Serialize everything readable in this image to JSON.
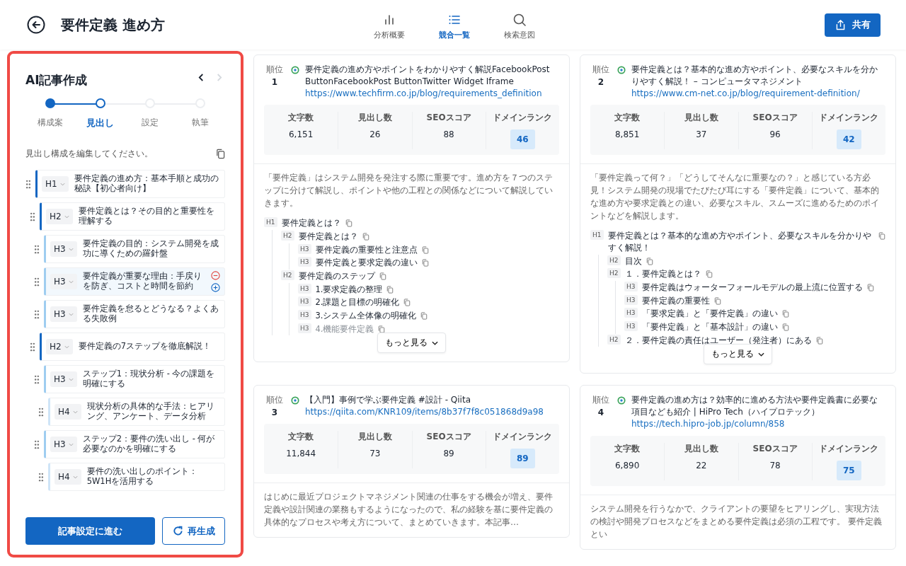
{
  "header": {
    "title": "要件定義 進め方",
    "tabs": [
      {
        "label": "分析概要",
        "kind": "bars",
        "selected": false
      },
      {
        "label": "競合一覧",
        "kind": "list",
        "selected": true
      },
      {
        "label": "検索意図",
        "kind": "search",
        "selected": false
      }
    ],
    "share_button": "共有"
  },
  "panel": {
    "title": "AI記事作成",
    "steps": [
      {
        "label": "構成案",
        "completed": true,
        "selected": false
      },
      {
        "label": "見出し",
        "completed": false,
        "selected": true
      },
      {
        "label": "設定",
        "completed": false,
        "selected": false
      },
      {
        "label": "執筆",
        "completed": false,
        "selected": false
      }
    ],
    "instruction": "見出し構成を編集してください。",
    "headings": [
      {
        "level": "H1",
        "text": "要件定義の進め方：基本手順と成功の秘訣【初心者向け】",
        "selected": false,
        "children": [
          {
            "level": "H2",
            "text": "要件定義とは？その目的と重要性を理解する",
            "selected": false,
            "children": [
              {
                "level": "H3",
                "text": "要件定義の目的：システム開発を成功に導くための羅針盤",
                "selected": false
              },
              {
                "level": "H3",
                "text": "要件定義が重要な理由：手戻りを防ぎ、コストと時間を節約",
                "selected": true
              },
              {
                "level": "H3",
                "text": "要件定義を怠るとどうなる？よくある失敗例",
                "selected": false
              }
            ]
          },
          {
            "level": "H2",
            "text": "要件定義の7ステップを徹底解説！",
            "selected": false,
            "children": [
              {
                "level": "H3",
                "text": "ステップ1：現状分析 - 今の課題を明確にする",
                "selected": false,
                "children": [
                  {
                    "level": "H4",
                    "text": "現状分析の具体的な手法：ヒアリング、アンケート、データ分析",
                    "selected": false
                  }
                ]
              },
              {
                "level": "H3",
                "text": "ステップ2：要件の洗い出し - 何が必要なのかを明確にする",
                "selected": false,
                "children": [
                  {
                    "level": "H4",
                    "text": "要件の洗い出しのポイント：5W1Hを活用する",
                    "selected": false
                  }
                ]
              }
            ]
          }
        ]
      }
    ],
    "primary_button": "記事設定に進む",
    "secondary_button": "再生成"
  },
  "cards": [
    {
      "rank_label": "順位",
      "rank": "1",
      "title": "要件定義の進め方やポイントをわかりやすく解説FacebookPost ButtonFacebookPost ButtonTwitter Widget Iframe",
      "url": "https://www.techfirm.co.jp/blog/requirements_definition",
      "stats": [
        {
          "label": "文字数",
          "value": "6,151",
          "kind": "plain"
        },
        {
          "label": "見出し数",
          "value": "26",
          "kind": "plain"
        },
        {
          "label": "SEOスコア",
          "value": "88",
          "kind": "plain"
        },
        {
          "label": "ドメインランク",
          "value": "46",
          "kind": "badge"
        }
      ],
      "description": "「要件定義」はシステム開発を発注する際に重要です。進め方を７つのステップに分けて解説し、ポイントや他の工程との関係などについて解説していきます。",
      "outline": [
        {
          "level": "H1",
          "text": "要件定義とは？",
          "children": [
            {
              "level": "H2",
              "text": "要件定義とは？",
              "children": [
                {
                  "level": "H3",
                  "text": "要件定義の重要性と注意点"
                },
                {
                  "level": "H3",
                  "text": "要件定義と要求定義の違い"
                }
              ]
            },
            {
              "level": "H2",
              "text": "要件定義のステップ",
              "children": [
                {
                  "level": "H3",
                  "text": "1.要求定義の整理"
                },
                {
                  "level": "H3",
                  "text": "2.課題と目標の明確化"
                },
                {
                  "level": "H3",
                  "text": "3.システム全体像の明確化"
                },
                {
                  "level": "H3",
                  "text": "4.機能要件定義",
                  "faded": true
                }
              ]
            }
          ]
        }
      ],
      "more_button": "もっと見る"
    },
    {
      "rank_label": "順位",
      "rank": "2",
      "title": "要件定義とは？基本的な進め方やポイント、必要なスキルを分かりやすく解説！ – コンピュータマネジメント",
      "url": "https://www.cm-net.co.jp/blog/requirement-definition/",
      "stats": [
        {
          "label": "文字数",
          "value": "8,851",
          "kind": "plain"
        },
        {
          "label": "見出し数",
          "value": "37",
          "kind": "plain"
        },
        {
          "label": "SEOスコア",
          "value": "96",
          "kind": "plain"
        },
        {
          "label": "ドメインランク",
          "value": "42",
          "kind": "badge"
        }
      ],
      "description": "「要件定義って何？」「どうしてそんなに重要なの？」と感じている方必見！システム開発の現場でたびたび耳にする「要件定義」について、基本的な進め方や要求定義との違い、必要なスキル、スムーズに進めるためのポイントなどを解説します。",
      "outline": [
        {
          "level": "H1",
          "text": "要件定義とは？基本的な進め方やポイント、必要なスキルを分かりやすく解説！",
          "children": [
            {
              "level": "H2",
              "text": "目次"
            },
            {
              "level": "H2",
              "text": "１．要件定義とは？",
              "children": [
                {
                  "level": "H3",
                  "text": "要件定義はウォーターフォールモデルの最上流に位置する"
                },
                {
                  "level": "H3",
                  "text": "要件定義の重要性"
                },
                {
                  "level": "H3",
                  "text": "「要求定義」と「要件定義」の違い"
                },
                {
                  "level": "H3",
                  "text": "「要件定義」と「基本設計」の違い"
                }
              ]
            },
            {
              "level": "H2",
              "text": "２．要件定義の責任はユーザー（発注者）にある"
            }
          ]
        }
      ],
      "more_button": "もっと見る"
    },
    {
      "rank_label": "順位",
      "rank": "3",
      "title": "【入門】事例で学ぶ要件定義 #設計 - Qiita",
      "url": "https://qiita.com/KNR109/items/8b37f7f8c051868d9a98",
      "stats": [
        {
          "label": "文字数",
          "value": "11,844",
          "kind": "plain"
        },
        {
          "label": "見出し数",
          "value": "73",
          "kind": "plain"
        },
        {
          "label": "SEOスコア",
          "value": "89",
          "kind": "plain"
        },
        {
          "label": "ドメインランク",
          "value": "89",
          "kind": "badge"
        }
      ],
      "description": "はじめに最近プロジェクトマネジメント関連の仕事をする機会が増え、要件定義や設計関連の業務もするようになったので、私の経験を基に要件定義の具体的なプロセスや考え方について、まとめていきます。本記事…"
    },
    {
      "rank_label": "順位",
      "rank": "4",
      "title": "要件定義の進め方は？効率的に進める方法や要件定義書に必要な項目なども紹介 | HiPro Tech（ハイプロテック）",
      "url": "https://tech.hipro-job.jp/column/858",
      "stats": [
        {
          "label": "文字数",
          "value": "6,890",
          "kind": "plain"
        },
        {
          "label": "見出し数",
          "value": "22",
          "kind": "plain"
        },
        {
          "label": "SEOスコア",
          "value": "78",
          "kind": "plain"
        },
        {
          "label": "ドメインランク",
          "value": "75",
          "kind": "badge"
        }
      ],
      "description": "システム開発を行うなかで、クライアントの要望をヒアリングし、実現方法の検討や開発プロセスなどをまとめる要件定義は必須の工程です。 要件定義とい"
    }
  ]
}
